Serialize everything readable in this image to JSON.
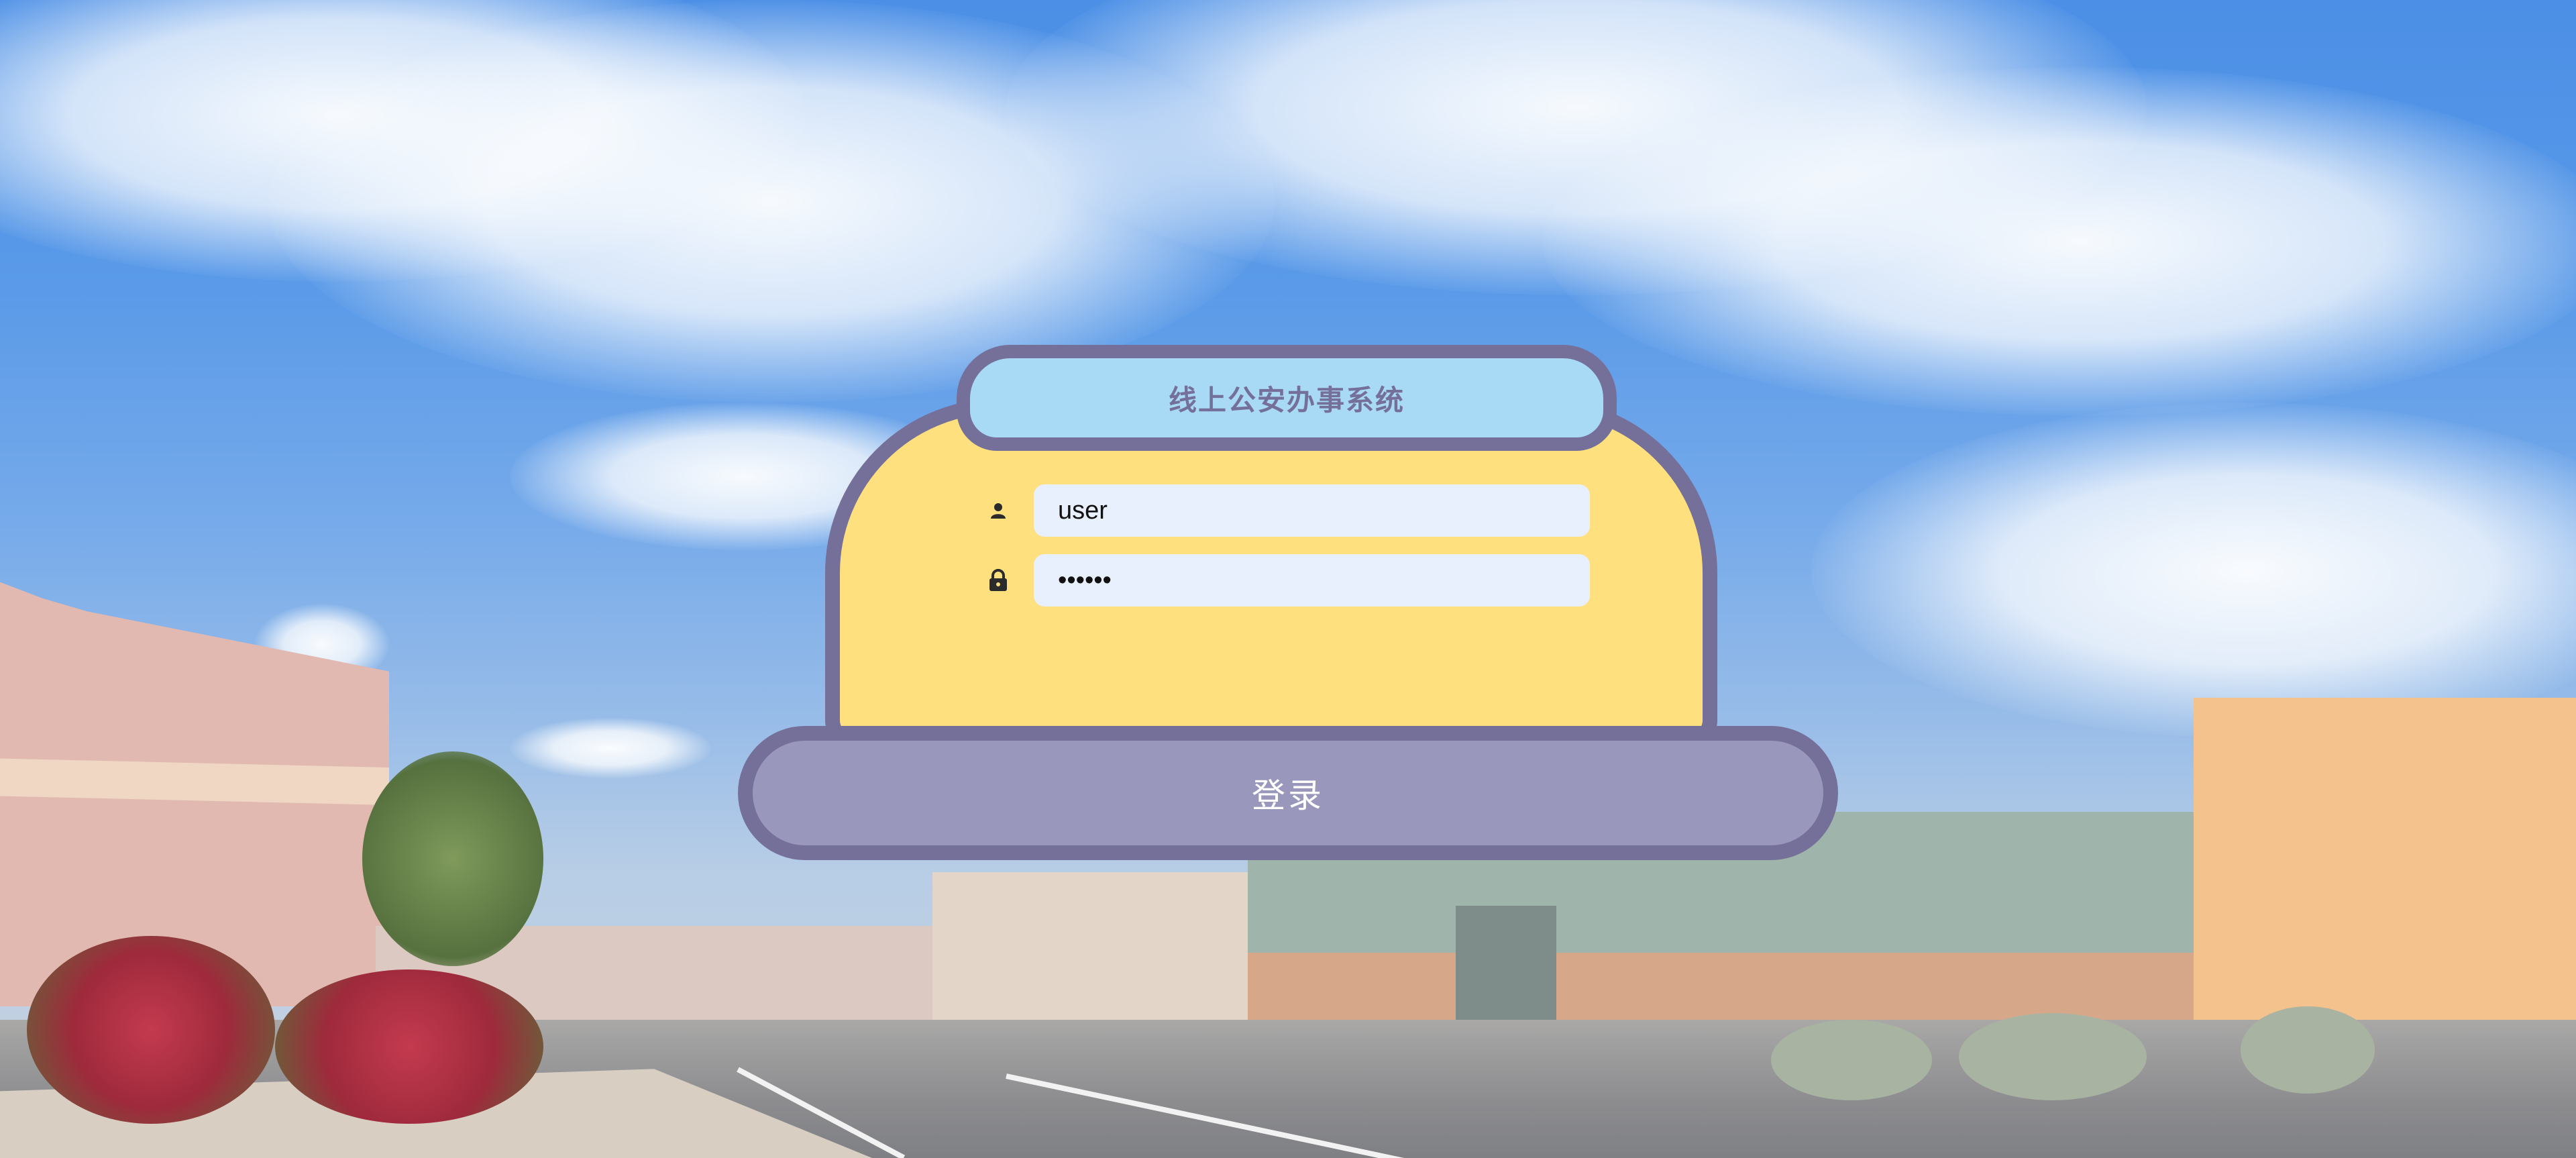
{
  "app": {
    "title": "线上公安办事系统"
  },
  "login_form": {
    "username_value": "user",
    "username_icon": "user-icon",
    "password_value": "••••••",
    "password_icon": "lock-icon",
    "submit_label": "登录"
  },
  "colors": {
    "card_fill": "#ffe07f",
    "card_border": "#757099",
    "title_fill": "#a8d9f5",
    "button_fill": "#9a97bd",
    "input_fill": "#e8f0fe"
  }
}
